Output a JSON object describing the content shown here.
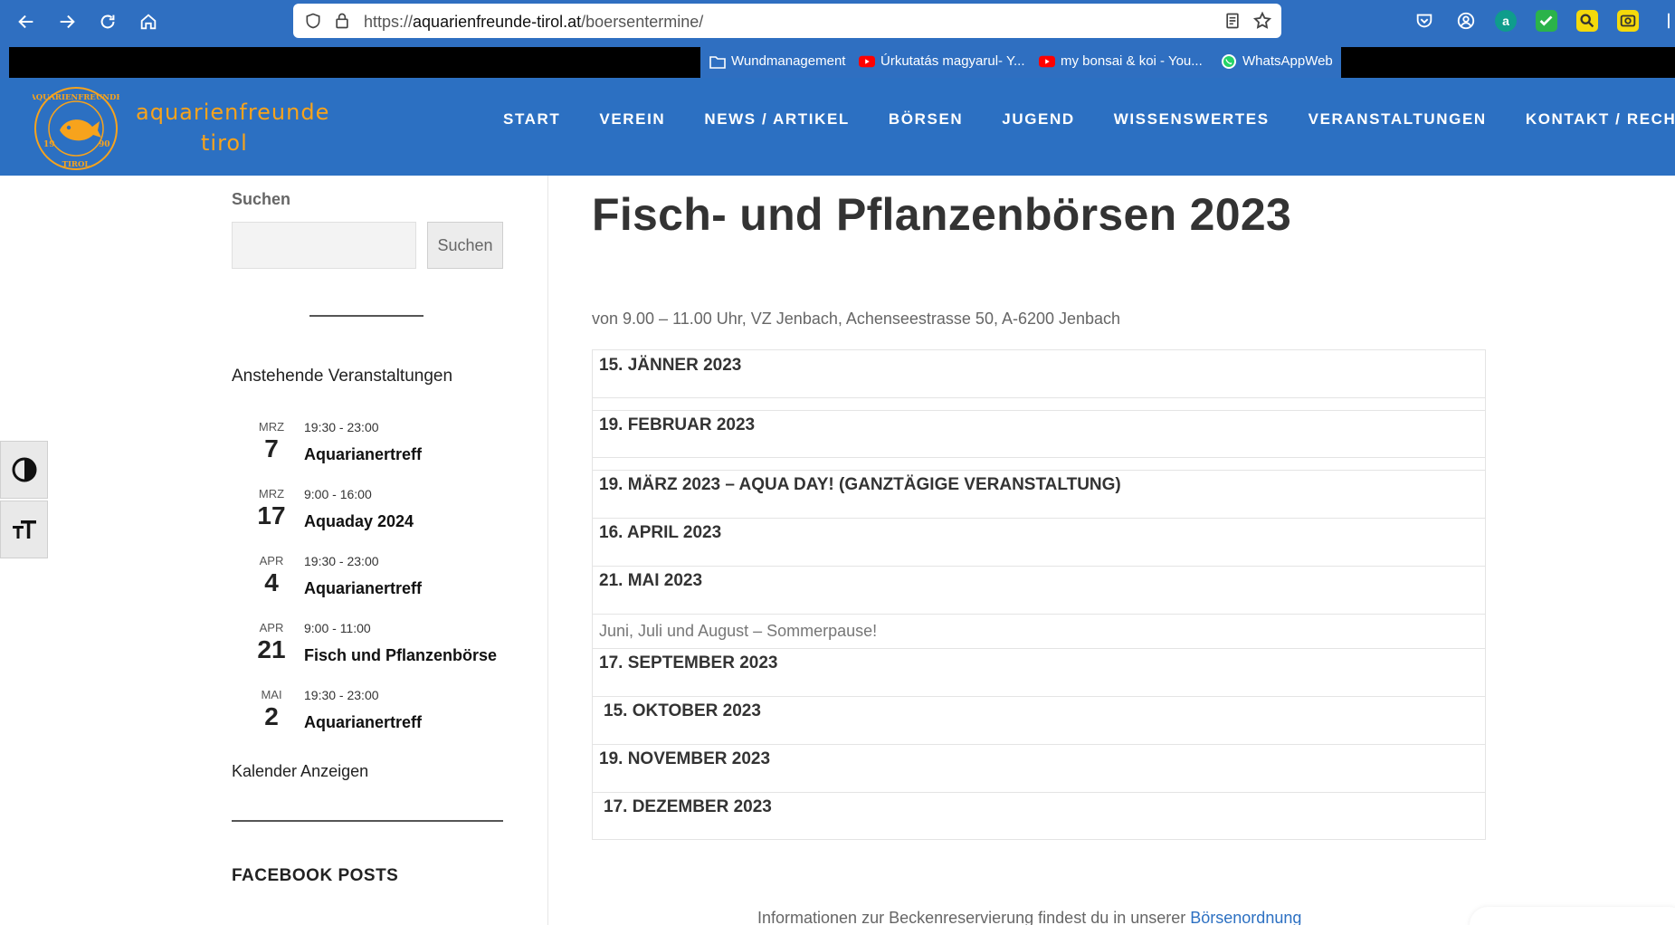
{
  "browser": {
    "url_scheme": "https://",
    "url_host": "aquarienfreunde-tirol.at",
    "url_path": "/boersentermine/",
    "bookmarks": [
      {
        "label": "Wundmanagement",
        "icon": "folder-icon"
      },
      {
        "label": "Úrkutatás magyarul- Y...",
        "icon": "youtube-icon"
      },
      {
        "label": "my bonsai & koi - You...",
        "icon": "youtube-icon"
      },
      {
        "label": "WhatsAppWeb",
        "icon": "whatsapp-icon"
      }
    ],
    "extension_letter": "a"
  },
  "header": {
    "logo_line1": "aquarienfreunde",
    "logo_line2": "tirol",
    "badge_top": "AQUARIENFREUNDE",
    "badge_bottom": "TIROL",
    "badge_left": "19",
    "badge_right": "90",
    "nav": [
      "START",
      "VEREIN",
      "NEWS / ARTIKEL",
      "BÖRSEN",
      "JUGEND",
      "WISSENSWERTES",
      "VERANSTALTUNGEN",
      "KONTAKT / RECHTLICHE"
    ]
  },
  "sidebar": {
    "search_label": "Suchen",
    "search_placeholder": "",
    "search_button": "Suchen",
    "events_title": "Anstehende Veranstaltungen",
    "events": [
      {
        "month": "MRZ",
        "day": "7",
        "time": "19:30 - 23:00",
        "title": "Aquarianertreff"
      },
      {
        "month": "MRZ",
        "day": "17",
        "time": "9:00 - 16:00",
        "title": "Aquaday 2024"
      },
      {
        "month": "APR",
        "day": "4",
        "time": "19:30 - 23:00",
        "title": "Aquarianertreff"
      },
      {
        "month": "APR",
        "day": "21",
        "time": "9:00 - 11:00",
        "title": "Fisch und Pflanzenbörse"
      },
      {
        "month": "MAI",
        "day": "2",
        "time": "19:30 - 23:00",
        "title": "Aquarianertreff"
      }
    ],
    "calendar_link": "Kalender Anzeigen",
    "facebook_title": "FACEBOOK POSTS"
  },
  "main": {
    "title": "Fisch- und Pflanzenbörsen 2023",
    "intro": "von 9.00 – 11.00 Uhr, VZ Jenbach, Achenseestrasse 50, A-6200 Jenbach",
    "dates": [
      "15. JÄNNER 2023",
      "19. FEBRUAR 2023",
      "19. MÄRZ 2023  –  AQUA DAY! (GANZTÄGIGE VERANSTALTUNG)",
      "16. APRIL 2023",
      "21. MAI 2023",
      "17. SEPTEMBER 2023",
      "15. OKTOBER 2023",
      "19. NOVEMBER 2023",
      "17. DEZEMBER 2023"
    ],
    "summer_note": "Juni, Juli und August – Sommerpause!",
    "bottom_text": "Informationen zur Beckenreservierung findest du in unserer ",
    "bottom_link": "Börsenordnung"
  },
  "colors": {
    "header_blue": "#2c70c2",
    "logo_orange": "#f7a31c"
  }
}
